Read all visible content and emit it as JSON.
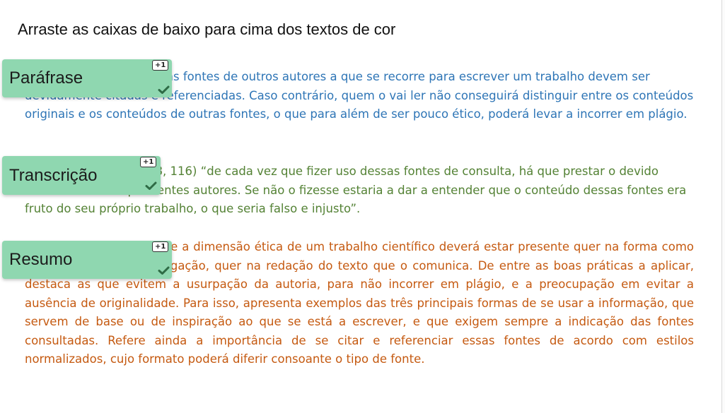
{
  "colors": {
    "paragraph_1": "#2e75b6",
    "paragraph_2": "#548235",
    "paragraph_3": "#c55a11",
    "chip_background": "#8fd7b0",
    "check": "#2e6b45"
  },
  "instruction": "Arraste as caixas de baixo para cima dos textos de cor",
  "paragraphs": [
    {
      "text": "É importante que todas as fontes de outros autores a que se recorre para escrever um trabalho devem ser devidamente citadas e referenciadas. Caso contrário, quem o vai ler não conseguirá distinguir entre os conteúdos originais e os conteúdos de outras fontes, o que para além de ser pouco ético, poderá levar a incorrer em plágio."
    },
    {
      "text": "Segundo Oliveira (2018, 116) “de cada vez que fizer uso dessas fontes de consulta, há que prestar o devido tributo aos correspondentes autores. Se não o fizesse estaria a dar a entender que o conteúdo dessas fontes era fruto do seu próprio trabalho, o que seria falso e injusto”."
    },
    {
      "text": "Oliveira (2018) refere que a dimensão ética de um trabalho científico deverá estar presente quer na forma como é desenvolvida a investigação, quer na redação do texto que o comunica. De entre as boas práticas a aplicar, destaca as que evitem a usurpação da autoria, para não incorrer em plágio, e a preocupação em evitar a ausência de originalidade. Para isso, apresenta exemplos das três principais formas de se usar a informação, que servem de base ou de inspiração ao que se está a escrever, e que exigem sempre a indicação das fontes consultadas. Refere ainda a importância de se citar e referenciar essas fontes de acordo com estilos normalizados, cujo formato poderá diferir consoante o tipo de fonte."
    }
  ],
  "chips": [
    {
      "label": "Paráfrase",
      "badge": "+1",
      "status_icon": "check-icon",
      "correct": true
    },
    {
      "label": "Transcrição",
      "badge": "+1",
      "status_icon": "check-icon",
      "correct": true
    },
    {
      "label": "Resumo",
      "badge": "+1",
      "status_icon": "check-icon",
      "correct": true
    }
  ]
}
